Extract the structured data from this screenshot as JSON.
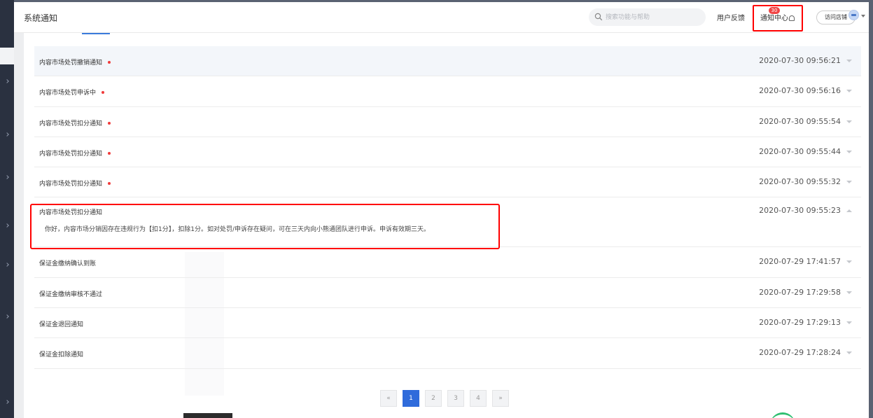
{
  "header": {
    "title": "系统通知",
    "search_placeholder": "搜索功能与帮助",
    "feedback_label": "用户反馈",
    "notify_label": "通知中心",
    "notify_badge": "30",
    "visit_store_label": "访问店铺"
  },
  "notifications": [
    {
      "title": "内容市场处罚撤销通知",
      "time": "2020-07-30 09:56:21"
    },
    {
      "title": "内容市场处罚申诉中",
      "time": "2020-07-30 09:56:16"
    },
    {
      "title": "内容市场处罚扣分通知",
      "time": "2020-07-30 09:55:54"
    },
    {
      "title": "内容市场处罚扣分通知",
      "time": "2020-07-30 09:55:44"
    },
    {
      "title": "内容市场处罚扣分通知",
      "time": "2020-07-30 09:55:32"
    },
    {
      "title": "内容市场处罚扣分通知",
      "time": "2020-07-30 09:55:23",
      "body": "你好，内容市场分销因存在违规行为【扣1分】，扣除1分。如对处罚/申诉存在疑问，可在三天内向小熊通团队进行申诉。申诉有效期三天。"
    },
    {
      "title": "保证金缴纳确认到账",
      "time": "2020-07-29 17:41:57"
    },
    {
      "title": "保证金缴纳审核不通过",
      "time": "2020-07-29 17:29:58"
    },
    {
      "title": "保证金退回通知",
      "time": "2020-07-29 17:29:13"
    },
    {
      "title": "保证金扣除通知",
      "time": "2020-07-29 17:28:24"
    }
  ],
  "pagination": {
    "prev": "«",
    "pages": [
      "1",
      "2",
      "3",
      "4"
    ],
    "current": "1",
    "next": "»"
  },
  "colors": {
    "accent": "#2f6bdb",
    "unread_dot": "#f03c3c",
    "highlight_box": "#ff0000",
    "sidebar": "#2a3140"
  }
}
